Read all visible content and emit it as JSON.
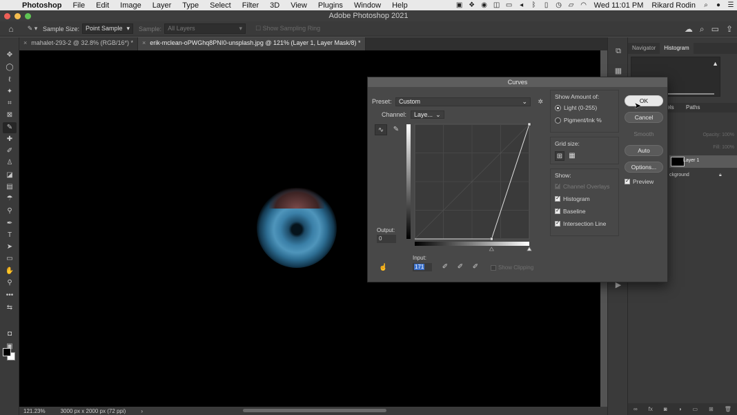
{
  "menubar": {
    "app_name": "Photoshop",
    "items": [
      "File",
      "Edit",
      "Image",
      "Layer",
      "Type",
      "Select",
      "Filter",
      "3D",
      "View",
      "Plugins",
      "Window",
      "Help"
    ],
    "clock": "Wed 11:01 PM",
    "user": "Rikard Rodin"
  },
  "window": {
    "title": "Adobe Photoshop 2021"
  },
  "options_bar": {
    "sample_size_label": "Sample Size:",
    "sample_size_value": "Point Sample",
    "sample_label": "Sample:",
    "sample_value": "All Layers",
    "show_sampling_ring": "Show Sampling Ring"
  },
  "tabs": [
    {
      "label": "mahalet-293-2 @ 32.8% (RGB/16*) *",
      "active": false
    },
    {
      "label": "erik-mclean-oPWGhq8PNI0-unsplash.jpg @ 121% (Layer 1, Layer Mask/8) *",
      "active": true
    }
  ],
  "status": {
    "zoom": "121.23%",
    "doc_size": "3000 px x 2000 px (72 ppi)"
  },
  "panels": {
    "top_tabs": [
      "Navigator",
      "Histogram"
    ],
    "active_top_tab": "Histogram",
    "layer_tabs": [
      "nels",
      "Paths"
    ],
    "opacity_label": "Opacity:",
    "opacity_value": "100%",
    "fill_label": "Fill:",
    "fill_value": "100%",
    "layers": [
      "Layer 1",
      "ckground"
    ]
  },
  "curves": {
    "title": "Curves",
    "preset_label": "Preset:",
    "preset_value": "Custom",
    "channel_label": "Channel:",
    "channel_value": "Laye...",
    "output_label": "Output:",
    "output_value": "0",
    "input_label": "Input:",
    "input_value": "171",
    "show_clipping": "Show Clipping",
    "show_amount_title": "Show Amount of:",
    "light_label": "Light  (0-255)",
    "pigment_label": "Pigment/Ink %",
    "grid_size_title": "Grid size:",
    "show_title": "Show:",
    "checks": [
      {
        "label": "Channel Overlays",
        "checked": true,
        "disabled": true
      },
      {
        "label": "Histogram",
        "checked": true,
        "disabled": false
      },
      {
        "label": "Baseline",
        "checked": true,
        "disabled": false
      },
      {
        "label": "Intersection Line",
        "checked": true,
        "disabled": false
      }
    ],
    "buttons": {
      "ok": "OK",
      "cancel": "Cancel",
      "smooth": "Smooth",
      "auto": "Auto",
      "options": "Options..."
    },
    "preview_label": "Preview",
    "curve_points": [
      [
        171,
        0
      ],
      [
        255,
        255
      ]
    ],
    "curve_range": [
      0,
      255
    ]
  }
}
